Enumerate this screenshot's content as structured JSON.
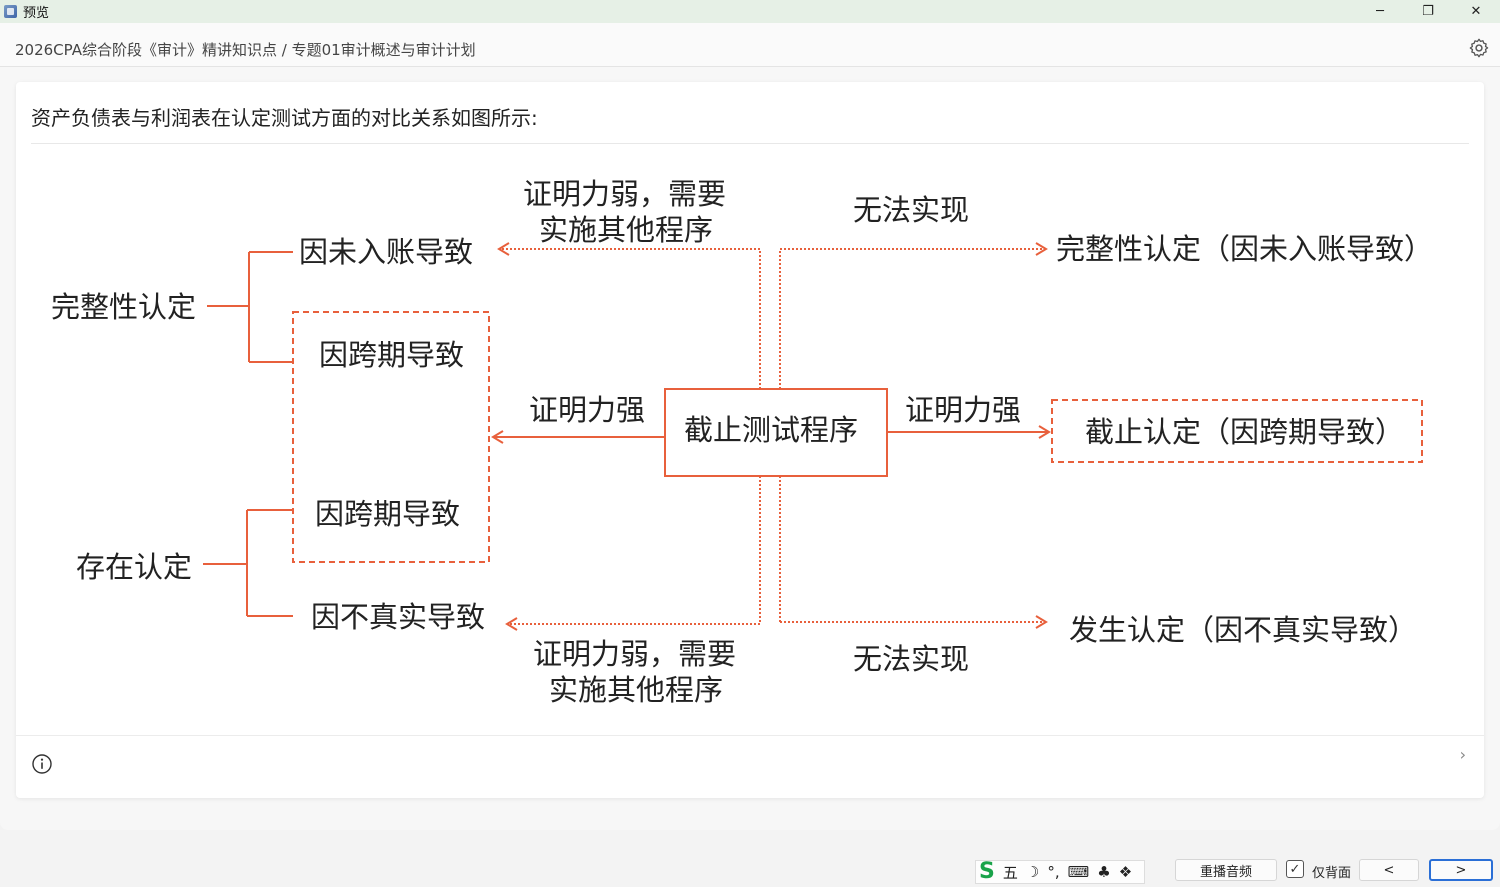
{
  "window": {
    "title": "预览",
    "controls": {
      "minimize": "─",
      "maximize": "❐",
      "close": "✕"
    }
  },
  "header": {
    "breadcrumb": "2026CPA综合阶段《审计》精讲知识点 / 专题01审计概述与审计计划"
  },
  "card": {
    "title": "资产负债表与利润表在认定测试方面的对比关系如图所示:",
    "next_chevron": "›"
  },
  "diagram": {
    "left_top_root": "完整性认定",
    "left_top_branch_1": "因未入账导致",
    "left_top_branch_2": "因跨期导致",
    "left_bottom_root": "存在认定",
    "left_bottom_branch_1": "因跨期导致",
    "left_bottom_branch_2": "因不真实导致",
    "center_box": "截止测试程序",
    "top_left_label_line1": "证明力弱，需要",
    "top_left_label_line2": "实施其他程序",
    "top_right_label": "无法实现",
    "middle_left_label": "证明力强",
    "middle_right_label": "证明力强",
    "bottom_left_label_line1": "证明力弱，需要",
    "bottom_left_label_line2": "实施其他程序",
    "bottom_right_label": "无法实现",
    "right_top_target": "完整性认定（因未入账导致）",
    "right_middle_target": "截止认定（因跨期导致）",
    "right_bottom_target": "发生认定（因不真实导致）",
    "accent_color": "#e8603c"
  },
  "bottom_bar": {
    "ime_logo": "S",
    "ime_mode": "五",
    "ime_items": [
      "☽",
      "°,",
      "⌨",
      "♣",
      "❖"
    ],
    "replay_label": "重播音频",
    "checkbox_mark": "✓",
    "only_back_label": "仅背面",
    "prev_label": "<",
    "next_label": ">"
  }
}
